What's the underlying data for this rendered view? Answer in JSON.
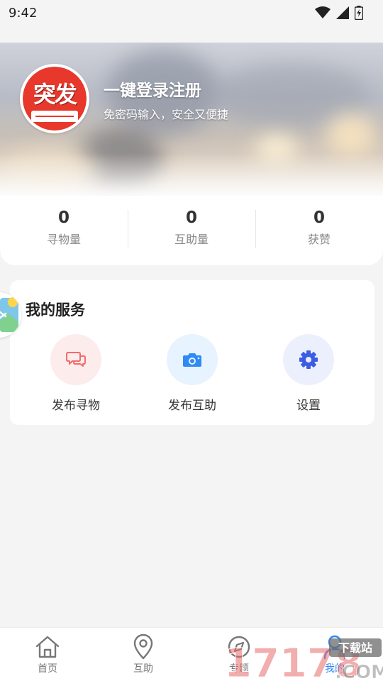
{
  "status_bar": {
    "time": "9:42"
  },
  "profile": {
    "avatar_text": "突发",
    "login_title": "一键登录注册",
    "login_subtitle": "免密码输入，安全又便捷"
  },
  "stats": [
    {
      "value": "0",
      "label": "寻物量"
    },
    {
      "value": "0",
      "label": "互助量"
    },
    {
      "value": "0",
      "label": "获赞"
    }
  ],
  "services": {
    "title": "我的服务",
    "items": [
      {
        "label": "发布寻物",
        "icon": "chat-bubbles-icon",
        "color": "#f36b6b",
        "bg": "#fdecec"
      },
      {
        "label": "发布互助",
        "icon": "camera-icon",
        "color": "#2f8af5",
        "bg": "#e7f3fe"
      },
      {
        "label": "设置",
        "icon": "gear-icon",
        "color": "#3d5ce6",
        "bg": "#ecf0fd"
      }
    ]
  },
  "tabbar": {
    "items": [
      {
        "label": "首页",
        "icon": "home-icon"
      },
      {
        "label": "互助",
        "icon": "location-pin-icon"
      },
      {
        "label": "专题",
        "icon": "topic-icon"
      },
      {
        "label": "我的",
        "icon": "user-icon",
        "active": true
      }
    ]
  },
  "watermark": {
    "text": "17178",
    "suffix": ".COM",
    "badge": "下载站"
  }
}
